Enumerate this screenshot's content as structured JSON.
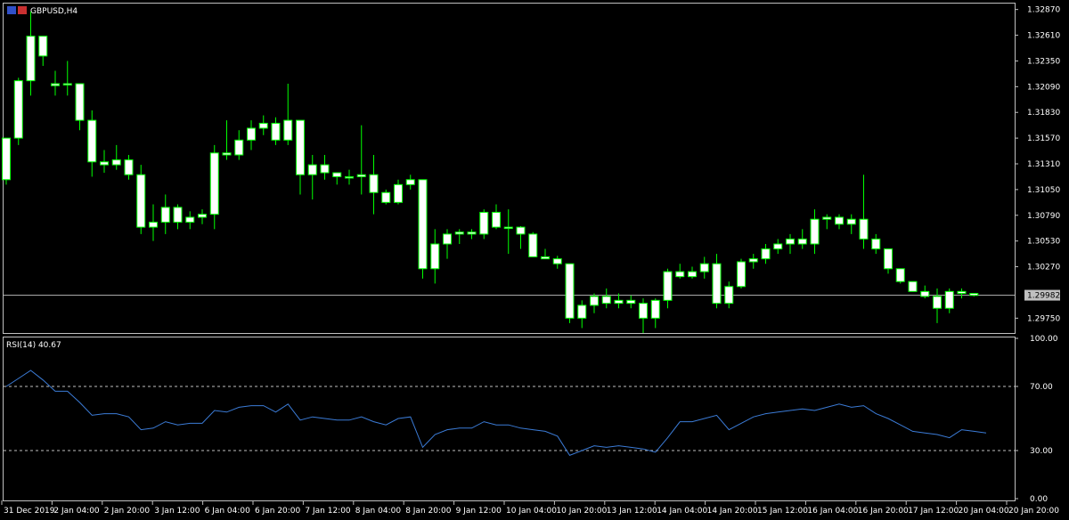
{
  "window": {
    "title": "GBPUSD,H4"
  },
  "colors": {
    "background": "#000000",
    "foreground": "#ffffff",
    "grid": "#c0c0c0",
    "bull_fill": "#ffffff",
    "bear_fill": "#ffffff",
    "wick": "#00ff00",
    "rsi_line": "#3b7bd6",
    "level_line": "#c0c0c0",
    "current_price_box": "#c0c0c0"
  },
  "price_axis": {
    "labels": [
      "1.32870",
      "1.32610",
      "1.32350",
      "1.32090",
      "1.31830",
      "1.31570",
      "1.31310",
      "1.31050",
      "1.30790",
      "1.30530",
      "1.30270",
      "1.29750"
    ],
    "current_price": "1.29982"
  },
  "rsi": {
    "label": "RSI(14) 40.67",
    "axis_labels": [
      "100.00",
      "70.00",
      "30.00",
      "0.00"
    ],
    "levels": [
      70,
      30
    ]
  },
  "time_axis": {
    "labels": [
      "31 Dec 2019",
      "2 Jan 04:00",
      "2 Jan 20:00",
      "3 Jan 12:00",
      "6 Jan 04:00",
      "6 Jan 20:00",
      "7 Jan 12:00",
      "8 Jan 04:00",
      "8 Jan 20:00",
      "9 Jan 12:00",
      "10 Jan 04:00",
      "10 Jan 20:00",
      "13 Jan 12:00",
      "14 Jan 04:00",
      "14 Jan 20:00",
      "15 Jan 12:00",
      "16 Jan 04:00",
      "16 Jan 20:00",
      "17 Jan 12:00",
      "20 Jan 04:00",
      "20 Jan 20:00"
    ]
  },
  "chart_data": {
    "type": "candlestick",
    "symbol": "GBPUSD",
    "timeframe": "H4",
    "ylim": [
      1.296,
      1.3293
    ],
    "candles": [
      [
        1.3115,
        1.3157,
        1.311,
        1.3157
      ],
      [
        1.3157,
        1.3218,
        1.315,
        1.3215
      ],
      [
        1.3215,
        1.3285,
        1.32,
        1.326
      ],
      [
        1.326,
        1.326,
        1.323,
        1.324
      ],
      [
        1.321,
        1.3225,
        1.32,
        1.3212
      ],
      [
        1.3212,
        1.3235,
        1.32,
        1.3212
      ],
      [
        1.3212,
        1.3212,
        1.3165,
        1.3175
      ],
      [
        1.3175,
        1.3185,
        1.3118,
        1.3133
      ],
      [
        1.3133,
        1.3145,
        1.3122,
        1.313
      ],
      [
        1.313,
        1.315,
        1.3125,
        1.3135
      ],
      [
        1.3135,
        1.314,
        1.3115,
        1.312
      ],
      [
        1.312,
        1.313,
        1.306,
        1.3067
      ],
      [
        1.3067,
        1.309,
        1.3053,
        1.3072
      ],
      [
        1.3072,
        1.31,
        1.306,
        1.3087
      ],
      [
        1.3087,
        1.309,
        1.3065,
        1.3072
      ],
      [
        1.3072,
        1.3083,
        1.3065,
        1.3077
      ],
      [
        1.3077,
        1.3085,
        1.307,
        1.308
      ],
      [
        1.308,
        1.315,
        1.3065,
        1.3142
      ],
      [
        1.3142,
        1.3175,
        1.3135,
        1.314
      ],
      [
        1.314,
        1.3165,
        1.3135,
        1.3155
      ],
      [
        1.3155,
        1.3175,
        1.3145,
        1.3167
      ],
      [
        1.3167,
        1.318,
        1.316,
        1.3172
      ],
      [
        1.3172,
        1.3178,
        1.315,
        1.3155
      ],
      [
        1.3155,
        1.3212,
        1.315,
        1.3175
      ],
      [
        1.3175,
        1.3175,
        1.31,
        1.312
      ],
      [
        1.312,
        1.314,
        1.3095,
        1.313
      ],
      [
        1.313,
        1.314,
        1.3115,
        1.3122
      ],
      [
        1.3122,
        1.3122,
        1.311,
        1.3118
      ],
      [
        1.3118,
        1.3125,
        1.311,
        1.3118
      ],
      [
        1.3118,
        1.317,
        1.31,
        1.312
      ],
      [
        1.312,
        1.314,
        1.308,
        1.3102
      ],
      [
        1.3102,
        1.3105,
        1.309,
        1.3092
      ],
      [
        1.3092,
        1.3115,
        1.309,
        1.311
      ],
      [
        1.311,
        1.312,
        1.3105,
        1.3115
      ],
      [
        1.3115,
        1.3115,
        1.3015,
        1.3025
      ],
      [
        1.3025,
        1.3065,
        1.301,
        1.305
      ],
      [
        1.305,
        1.3065,
        1.3035,
        1.306
      ],
      [
        1.306,
        1.3065,
        1.305,
        1.3062
      ],
      [
        1.3062,
        1.3065,
        1.3055,
        1.306
      ],
      [
        1.306,
        1.3085,
        1.3055,
        1.3082
      ],
      [
        1.3082,
        1.309,
        1.3065,
        1.3067
      ],
      [
        1.3067,
        1.3085,
        1.304,
        1.3067
      ],
      [
        1.3067,
        1.3068,
        1.3045,
        1.306
      ],
      [
        1.306,
        1.3062,
        1.304,
        1.3037
      ],
      [
        1.3037,
        1.3045,
        1.3035,
        1.3035
      ],
      [
        1.3035,
        1.3038,
        1.3025,
        1.303
      ],
      [
        1.303,
        1.303,
        1.297,
        1.2975
      ],
      [
        1.2975,
        1.2993,
        1.2965,
        1.2988
      ],
      [
        1.2988,
        1.3,
        1.298,
        1.2997
      ],
      [
        1.2997,
        1.3005,
        1.2985,
        1.299
      ],
      [
        1.299,
        1.3,
        1.2985,
        1.2993
      ],
      [
        1.2993,
        1.2998,
        1.2985,
        1.299
      ],
      [
        1.299,
        1.2995,
        1.296,
        1.2975
      ],
      [
        1.2975,
        1.2995,
        1.2965,
        1.2993
      ],
      [
        1.2993,
        1.3025,
        1.2985,
        1.3022
      ],
      [
        1.3022,
        1.303,
        1.3015,
        1.3017
      ],
      [
        1.3017,
        1.3027,
        1.3015,
        1.3022
      ],
      [
        1.3022,
        1.3037,
        1.3015,
        1.303
      ],
      [
        1.303,
        1.304,
        1.2985,
        1.299
      ],
      [
        1.299,
        1.3012,
        1.2985,
        1.3007
      ],
      [
        1.3007,
        1.3035,
        1.3005,
        1.3032
      ],
      [
        1.3032,
        1.304,
        1.3025,
        1.3035
      ],
      [
        1.3035,
        1.305,
        1.303,
        1.3045
      ],
      [
        1.3045,
        1.3055,
        1.304,
        1.305
      ],
      [
        1.305,
        1.306,
        1.304,
        1.3055
      ],
      [
        1.3055,
        1.3065,
        1.3045,
        1.305
      ],
      [
        1.305,
        1.3085,
        1.304,
        1.3075
      ],
      [
        1.3075,
        1.308,
        1.3065,
        1.3077
      ],
      [
        1.3077,
        1.308,
        1.3065,
        1.307
      ],
      [
        1.307,
        1.308,
        1.306,
        1.3075
      ],
      [
        1.3075,
        1.312,
        1.3045,
        1.3055
      ],
      [
        1.3055,
        1.306,
        1.304,
        1.3045
      ],
      [
        1.3045,
        1.3045,
        1.302,
        1.3025
      ],
      [
        1.3025,
        1.3025,
        1.301,
        1.3012
      ],
      [
        1.3012,
        1.3012,
        1.3005,
        1.3002
      ],
      [
        1.3002,
        1.3008,
        1.2995,
        1.2997
      ],
      [
        1.2997,
        1.3005,
        1.297,
        1.2985
      ],
      [
        1.2985,
        1.3005,
        1.298,
        1.3002
      ],
      [
        1.3002,
        1.3005,
        1.2995,
        1.3
      ],
      [
        1.3,
        1.3,
        1.2997,
        1.2998
      ]
    ],
    "rsi_values": [
      70,
      75,
      80,
      74,
      67,
      67,
      60,
      52,
      53,
      53,
      51,
      43,
      44,
      48,
      46,
      47,
      47,
      55,
      54,
      57,
      58,
      58,
      54,
      59,
      49,
      51,
      50,
      49,
      49,
      51,
      48,
      46,
      50,
      51,
      32,
      40,
      43,
      44,
      44,
      48,
      46,
      46,
      44,
      43,
      42,
      39,
      27,
      30,
      33,
      32,
      33,
      32,
      31,
      29,
      38,
      48,
      48,
      50,
      52,
      43,
      47,
      51,
      53,
      54,
      55,
      56,
      55,
      57,
      59,
      57,
      58,
      53,
      50,
      46,
      42,
      41,
      40,
      38,
      43,
      42,
      41
    ],
    "rsi_ylim": [
      0,
      100
    ]
  }
}
